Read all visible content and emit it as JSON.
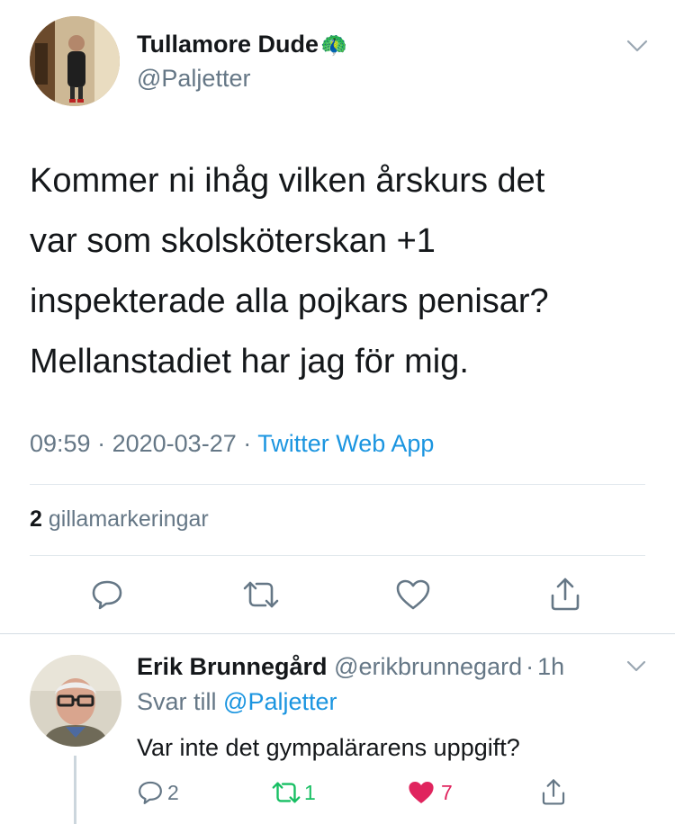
{
  "tweet": {
    "author_name": "Tullamore Dude",
    "author_emoji": "🦚",
    "author_handle": "@Paljetter",
    "text_line1": "Kommer ni ihåg vilken årskurs det",
    "text_line2": "var som skolsköterskan +1",
    "text_line3": "inspekterade alla pojkars penisar?",
    "text_line4": "Mellanstadiet har jag för mig.",
    "time": "09:59",
    "separator": "·",
    "date": "2020-03-27",
    "source": "Twitter Web App",
    "likes_count": "2",
    "likes_label": "gillamarkeringar"
  },
  "reply": {
    "author_name": "Erik Brunnegård",
    "author_handle": "@erikbrunnegard",
    "separator": "·",
    "age": "1h",
    "reply_prefix": "Svar till",
    "reply_to": "@Paljetter",
    "text": "Var inte det gympalärarens uppgift?",
    "reply_count": "2",
    "retweet_count": "1",
    "like_count": "7"
  },
  "colors": {
    "accent": "#1b95e0",
    "muted": "#657786",
    "retweet_active": "#17bf63",
    "like_active": "#e0245e"
  }
}
